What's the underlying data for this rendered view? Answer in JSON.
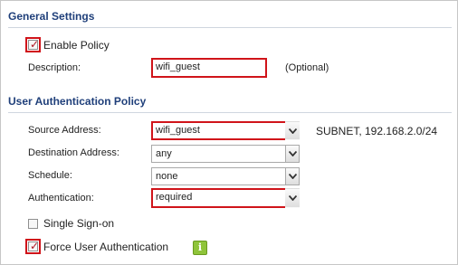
{
  "general": {
    "title": "General Settings",
    "enable_policy": {
      "label": "Enable Policy",
      "checked": true
    },
    "description": {
      "label": "Description:",
      "value": "wifi_guest",
      "hint": "(Optional)"
    }
  },
  "auth": {
    "title": "User Authentication Policy",
    "source": {
      "label": "Source Address:",
      "value": "wifi_guest",
      "detail": "SUBNET, 192.168.2.0/24"
    },
    "destination": {
      "label": "Destination Address:",
      "value": "any"
    },
    "schedule": {
      "label": "Schedule:",
      "value": "none"
    },
    "authentication": {
      "label": "Authentication:",
      "value": "required"
    },
    "single_sign_on": {
      "label": "Single Sign-on",
      "checked": false
    },
    "force_auth": {
      "label": "Force User Authentication",
      "checked": true,
      "info_icon": "i"
    }
  },
  "colors": {
    "highlight": "#d0141a",
    "title": "#1f3f7a",
    "info": "#8fc43a"
  }
}
